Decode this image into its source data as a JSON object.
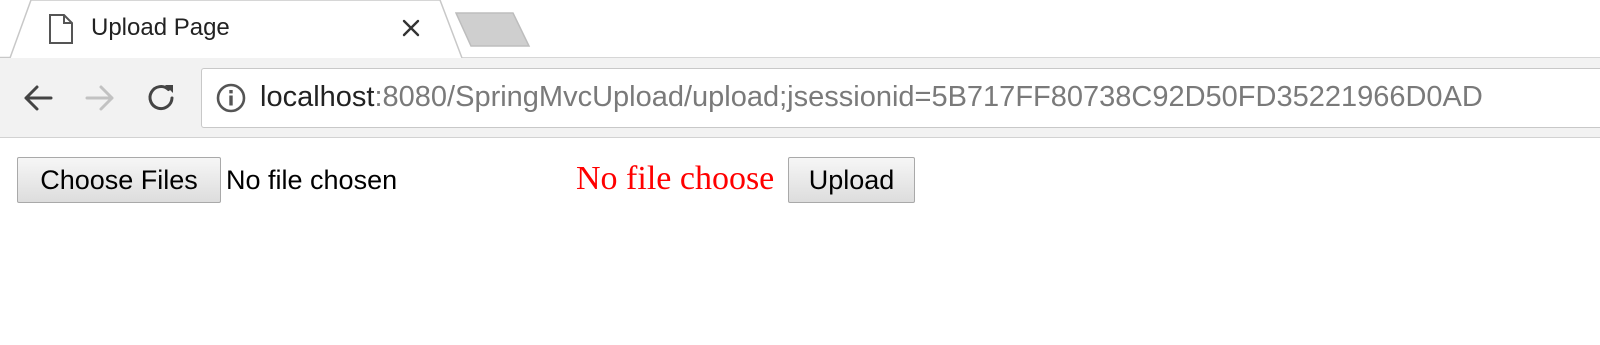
{
  "tab": {
    "title": "Upload Page",
    "page_icon": "page-icon",
    "close_icon": "close-icon",
    "new_tab_icon": "new-tab-button"
  },
  "toolbar": {
    "back_icon": "back-arrow-icon",
    "forward_icon": "forward-arrow-icon",
    "reload_icon": "reload-icon",
    "info_icon": "info-icon",
    "url_host": "localhost",
    "url_rest": ":8080/SpringMvcUpload/upload;jsessionid=5B717FF80738C92D50FD35221966D0AD"
  },
  "content": {
    "choose_files_label": "Choose Files",
    "file_status": "No file chosen",
    "message": "No file choose",
    "upload_label": "Upload"
  },
  "colors": {
    "message": "#ff0000",
    "toolbar_bg": "#f2f2f2",
    "url_rest": "#7a7a7a"
  }
}
